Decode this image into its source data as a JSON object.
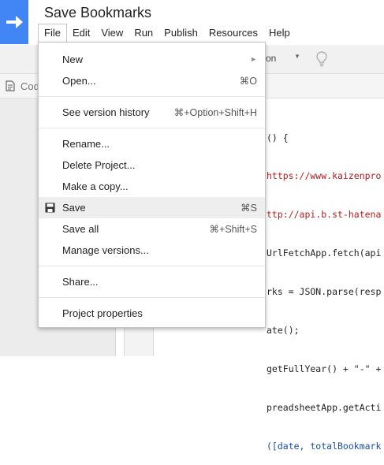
{
  "app": {
    "title": "Save Bookmarks",
    "brand_color": "#4285f4"
  },
  "menubar": [
    "File",
    "Edit",
    "View",
    "Run",
    "Publish",
    "Resources",
    "Help"
  ],
  "toolbar": {
    "function_select_fragment": "on"
  },
  "tab": {
    "label_fragment": "Cod"
  },
  "code_lines": [
    {
      "text": "() {",
      "style": "plain"
    },
    {
      "text": "https://www.kaizenpro",
      "style": "str"
    },
    {
      "text": "ttp://api.b.st-hatena",
      "style": "str"
    },
    {
      "text": "UrlFetchApp.fetch(api",
      "style": "plain"
    },
    {
      "text": "rks = JSON.parse(resp",
      "style": "plain"
    },
    {
      "text": "ate();",
      "style": "plain"
    },
    {
      "text": "getFullYear() + \"-\" +",
      "style": "plain"
    },
    {
      "text": "preadsheetApp.getActi",
      "style": "plain"
    },
    {
      "text": "([date, totalBookmark",
      "style": "blue"
    }
  ],
  "file_menu": {
    "new": {
      "label": "New"
    },
    "open": {
      "label": "Open...",
      "shortcut": "⌘O"
    },
    "version_history": {
      "label": "See version history",
      "shortcut": "⌘+Option+Shift+H"
    },
    "rename": {
      "label": "Rename..."
    },
    "delete": {
      "label": "Delete Project..."
    },
    "copy": {
      "label": "Make a copy..."
    },
    "save": {
      "label": "Save",
      "shortcut": "⌘S"
    },
    "save_all": {
      "label": "Save all",
      "shortcut": "⌘+Shift+S"
    },
    "manage_versions": {
      "label": "Manage versions..."
    },
    "share": {
      "label": "Share..."
    },
    "properties": {
      "label": "Project properties"
    }
  }
}
